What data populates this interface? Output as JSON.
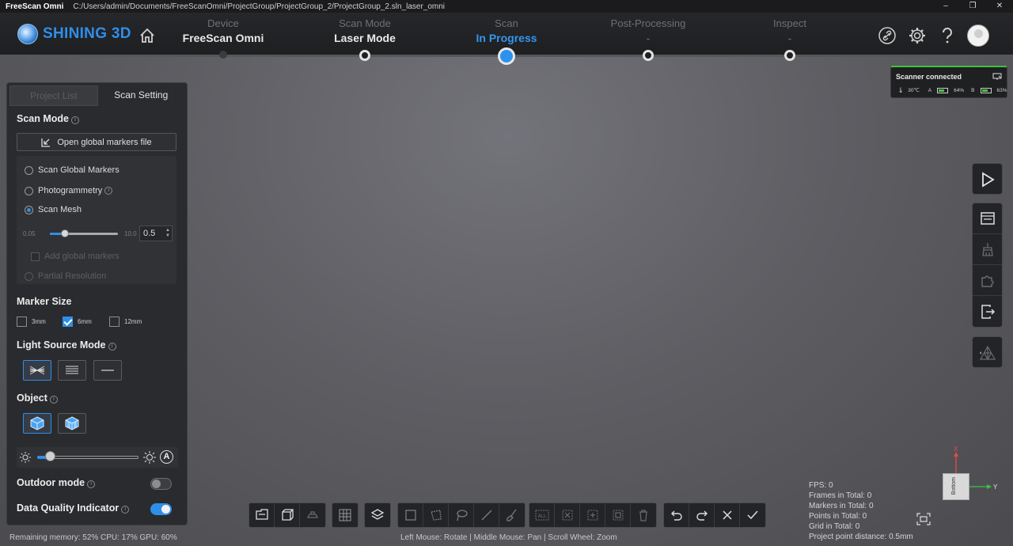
{
  "window": {
    "app_name": "FreeScan Omni",
    "path": "C:/Users/admin/Documents/FreeScanOmni/ProjectGroup/ProjectGroup_2/ProjectGroup_2.sln_laser_omni",
    "minimize": "–",
    "restore": "❐",
    "close": "✕"
  },
  "brand": {
    "name": "SHINING 3D"
  },
  "steps": [
    {
      "title": "Device",
      "value": "FreeScan Omni"
    },
    {
      "title": "Scan Mode",
      "value": "Laser Mode"
    },
    {
      "title": "Scan",
      "value": "In Progress"
    },
    {
      "title": "Post-Processing",
      "value": "-"
    },
    {
      "title": "Inspect",
      "value": "-"
    }
  ],
  "left_panel": {
    "tabs": [
      "Project List",
      "Scan Setting"
    ],
    "scan_mode": {
      "heading": "Scan Mode",
      "open_markers_label": "Open global markers file",
      "options": [
        "Scan Global Markers",
        "Photogrammetry",
        "Scan Mesh"
      ],
      "selected": "Scan Mesh",
      "resolution_min": "0.05",
      "resolution_max": "10.0",
      "resolution_value": "0.5",
      "add_global_markers": "Add global markers",
      "partial_resolution": "Partial Resolution"
    },
    "marker_size": {
      "heading": "Marker Size",
      "options": [
        "3mm",
        "6mm",
        "12mm"
      ],
      "selected": "6mm"
    },
    "light_source_mode": {
      "heading": "Light Source Mode"
    },
    "object": {
      "heading": "Object"
    },
    "brightness_auto": "A",
    "outdoor_mode": {
      "label": "Outdoor mode",
      "on": false
    },
    "data_quality": {
      "label": "Data Quality Indicator",
      "on": true
    }
  },
  "scanner_status": {
    "title": "Scanner connected",
    "temperature": "30℃",
    "battery_a_label": "A",
    "battery_a": "64%",
    "battery_b_label": "B",
    "battery_b": "63%"
  },
  "stats": {
    "fps": "FPS:  0",
    "frames": "Frames in Total: 0",
    "markers": "Markers in Total: 0",
    "points": "Points in Total: 0",
    "grid": "Grid in Total: 0",
    "point_distance": "Project point distance: 0.5mm"
  },
  "axes": {
    "x": "X",
    "y": "Y",
    "cube_face": "Bottom"
  },
  "status_bar": {
    "resources": "Remaining memory: 52% CPU: 17% GPU: 60%",
    "mouse_hint": "Left Mouse: Rotate | Middle Mouse: Pan | Scroll Wheel: Zoom"
  },
  "colors": {
    "accent": "#2e8fe8",
    "connected": "#3cc33c"
  }
}
